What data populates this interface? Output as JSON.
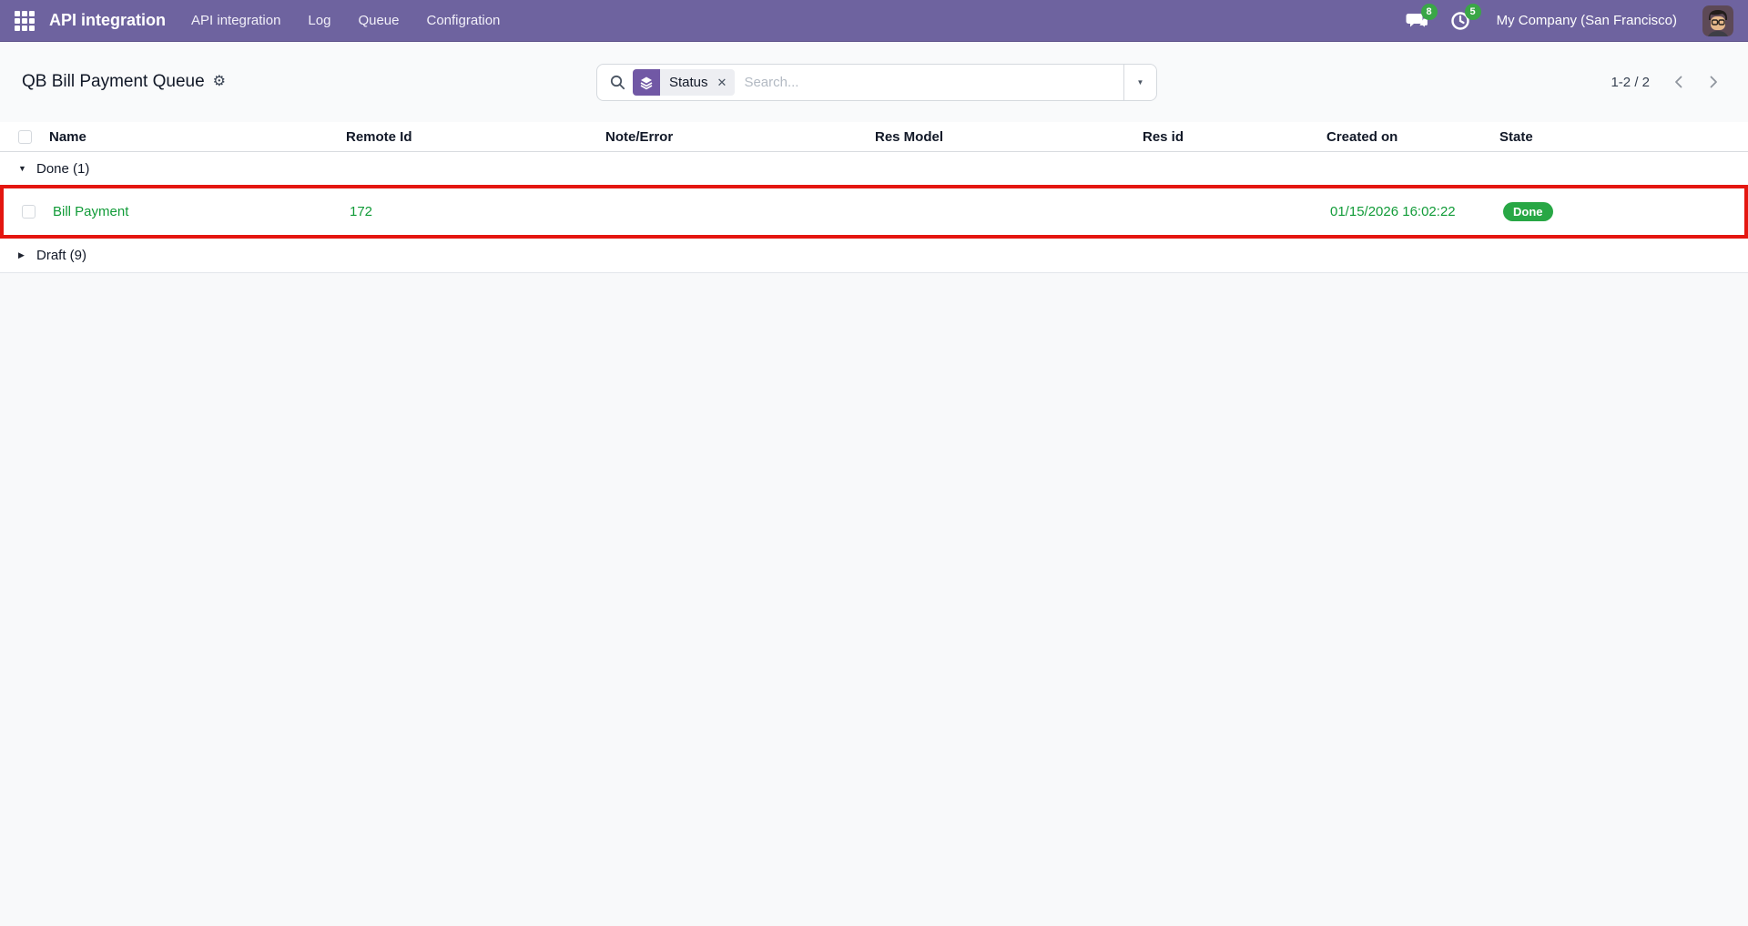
{
  "colors": {
    "navbar_bg": "#6e639f",
    "facet_icon_bg": "#7158a5",
    "success_text_green": "#119b38",
    "state_badge_green": "#28a745",
    "notification_badge_green": "#3aa647",
    "annotation_red": "#e41610"
  },
  "icons": {
    "gear": "⚙",
    "caret_down": "▼",
    "caret_right": "▶",
    "close": "✕",
    "dropdown_caret": "▼"
  },
  "navbar": {
    "app_name": "API integration",
    "menu_items": [
      {
        "label": "API integration"
      },
      {
        "label": "Log"
      },
      {
        "label": "Queue"
      },
      {
        "label": "Configration"
      }
    ],
    "messages_badge": "8",
    "activities_badge": "5",
    "company": "My Company (San Francisco)"
  },
  "control_panel": {
    "title": "QB Bill Payment Queue",
    "search": {
      "facet_label": "Status",
      "placeholder": "Search..."
    },
    "pager": {
      "value": "1-2 / 2"
    }
  },
  "table": {
    "columns": [
      "Name",
      "Remote Id",
      "Note/Error",
      "Res Model",
      "Res id",
      "Created on",
      "State"
    ],
    "groups": [
      {
        "label": "Done (1)",
        "rows": [
          {
            "name": "Bill Payment",
            "remote_id": "172",
            "note_error": "",
            "res_model": "",
            "res_id": "",
            "created_on": "01/15/2026 16:02:22",
            "state": "Done"
          }
        ]
      },
      {
        "label": "Draft (9)"
      }
    ]
  }
}
